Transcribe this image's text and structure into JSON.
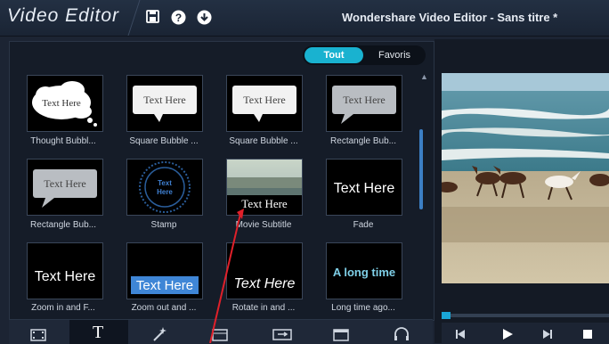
{
  "app": {
    "brand": "Video Editor",
    "window_title": "Wondershare Video Editor - Sans titre *"
  },
  "titlebar_icons": [
    {
      "name": "save-icon"
    },
    {
      "name": "help-icon"
    },
    {
      "name": "download-icon"
    }
  ],
  "filter": {
    "all_label": "Tout",
    "favorites_label": "Favoris",
    "selected": "Tout"
  },
  "grid": {
    "items": [
      {
        "label": "Thought Bubbl...",
        "thumb_text": "Text Here",
        "style": "thought-bubble"
      },
      {
        "label": "Square Bubble ...",
        "thumb_text": "Text Here",
        "style": "square-bubble"
      },
      {
        "label": "Square Bubble ...",
        "thumb_text": "Text Here",
        "style": "square-bubble"
      },
      {
        "label": "Rectangle Bub...",
        "thumb_text": "Text Here",
        "style": "rect-bubble"
      },
      {
        "label": "Rectangle Bub...",
        "thumb_text": "Text Here",
        "style": "rect-bubble"
      },
      {
        "label": "Stamp",
        "thumb_text": "Text Here",
        "style": "stamp"
      },
      {
        "label": "Movie Subtitle",
        "thumb_text": "Text Here",
        "style": "movie-subtitle"
      },
      {
        "label": "Fade",
        "thumb_text": "Text Here",
        "style": "fade"
      },
      {
        "label": "Zoom in and F...",
        "thumb_text": "Text Here",
        "style": "zoom-in"
      },
      {
        "label": "Zoom out and ...",
        "thumb_text": "Text Here",
        "style": "zoom-out"
      },
      {
        "label": "Rotate in and ...",
        "thumb_text": "Text Here",
        "style": "rotate"
      },
      {
        "label": "Long time ago...",
        "thumb_text": "A long time",
        "style": "long-time"
      }
    ]
  },
  "toolbar": {
    "tools": [
      {
        "name": "media-icon",
        "active": false
      },
      {
        "name": "text-icon",
        "active": true
      },
      {
        "name": "effects-icon",
        "active": false
      },
      {
        "name": "transitions-icon",
        "active": false
      },
      {
        "name": "pip-icon",
        "active": false
      },
      {
        "name": "intro-credit-icon",
        "active": false
      },
      {
        "name": "audio-icon",
        "active": false
      }
    ],
    "text_tool_glyph": "T"
  },
  "preview": {
    "timeline_progress": 0.0
  },
  "colors": {
    "accent": "#19b2d0",
    "background": "#1c2433",
    "annotation": "#e0202a"
  }
}
